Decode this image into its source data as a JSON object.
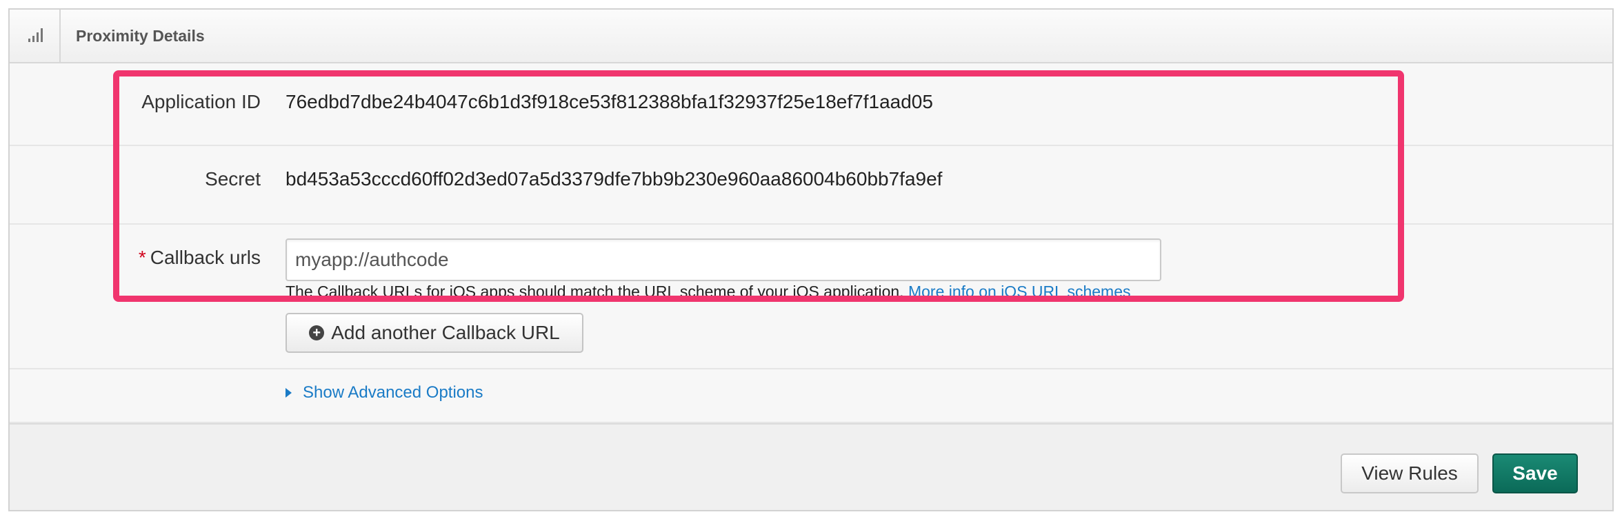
{
  "header": {
    "title": "Proximity Details",
    "icon": "signal-bars-icon"
  },
  "fields": {
    "application_id": {
      "label": "Application ID",
      "value": "76edbd7dbe24b4047c6b1d3f918ce53f812388bfa1f32937f25e18ef7f1aad05"
    },
    "secret": {
      "label": "Secret",
      "value": "bd453a53cccd60ff02d3ed07a5d3379dfe7bb9b230e960aa86004b60bb7fa9ef"
    },
    "callback_urls": {
      "required_mark": "*",
      "label": "Callback urls",
      "value": "myapp://authcode",
      "help_text": "The Callback URLs for iOS apps should match the URL scheme of your iOS application.",
      "help_link": "More info on iOS URL schemes",
      "add_button_label": "Add another Callback URL"
    }
  },
  "advanced": {
    "toggle_label": "Show Advanced Options"
  },
  "footer": {
    "view_rules_label": "View Rules",
    "save_label": "Save"
  },
  "colors": {
    "highlight": "#f0356e",
    "link": "#1a7bc6",
    "save_button": "#0b6a58",
    "required": "#d0021b"
  }
}
